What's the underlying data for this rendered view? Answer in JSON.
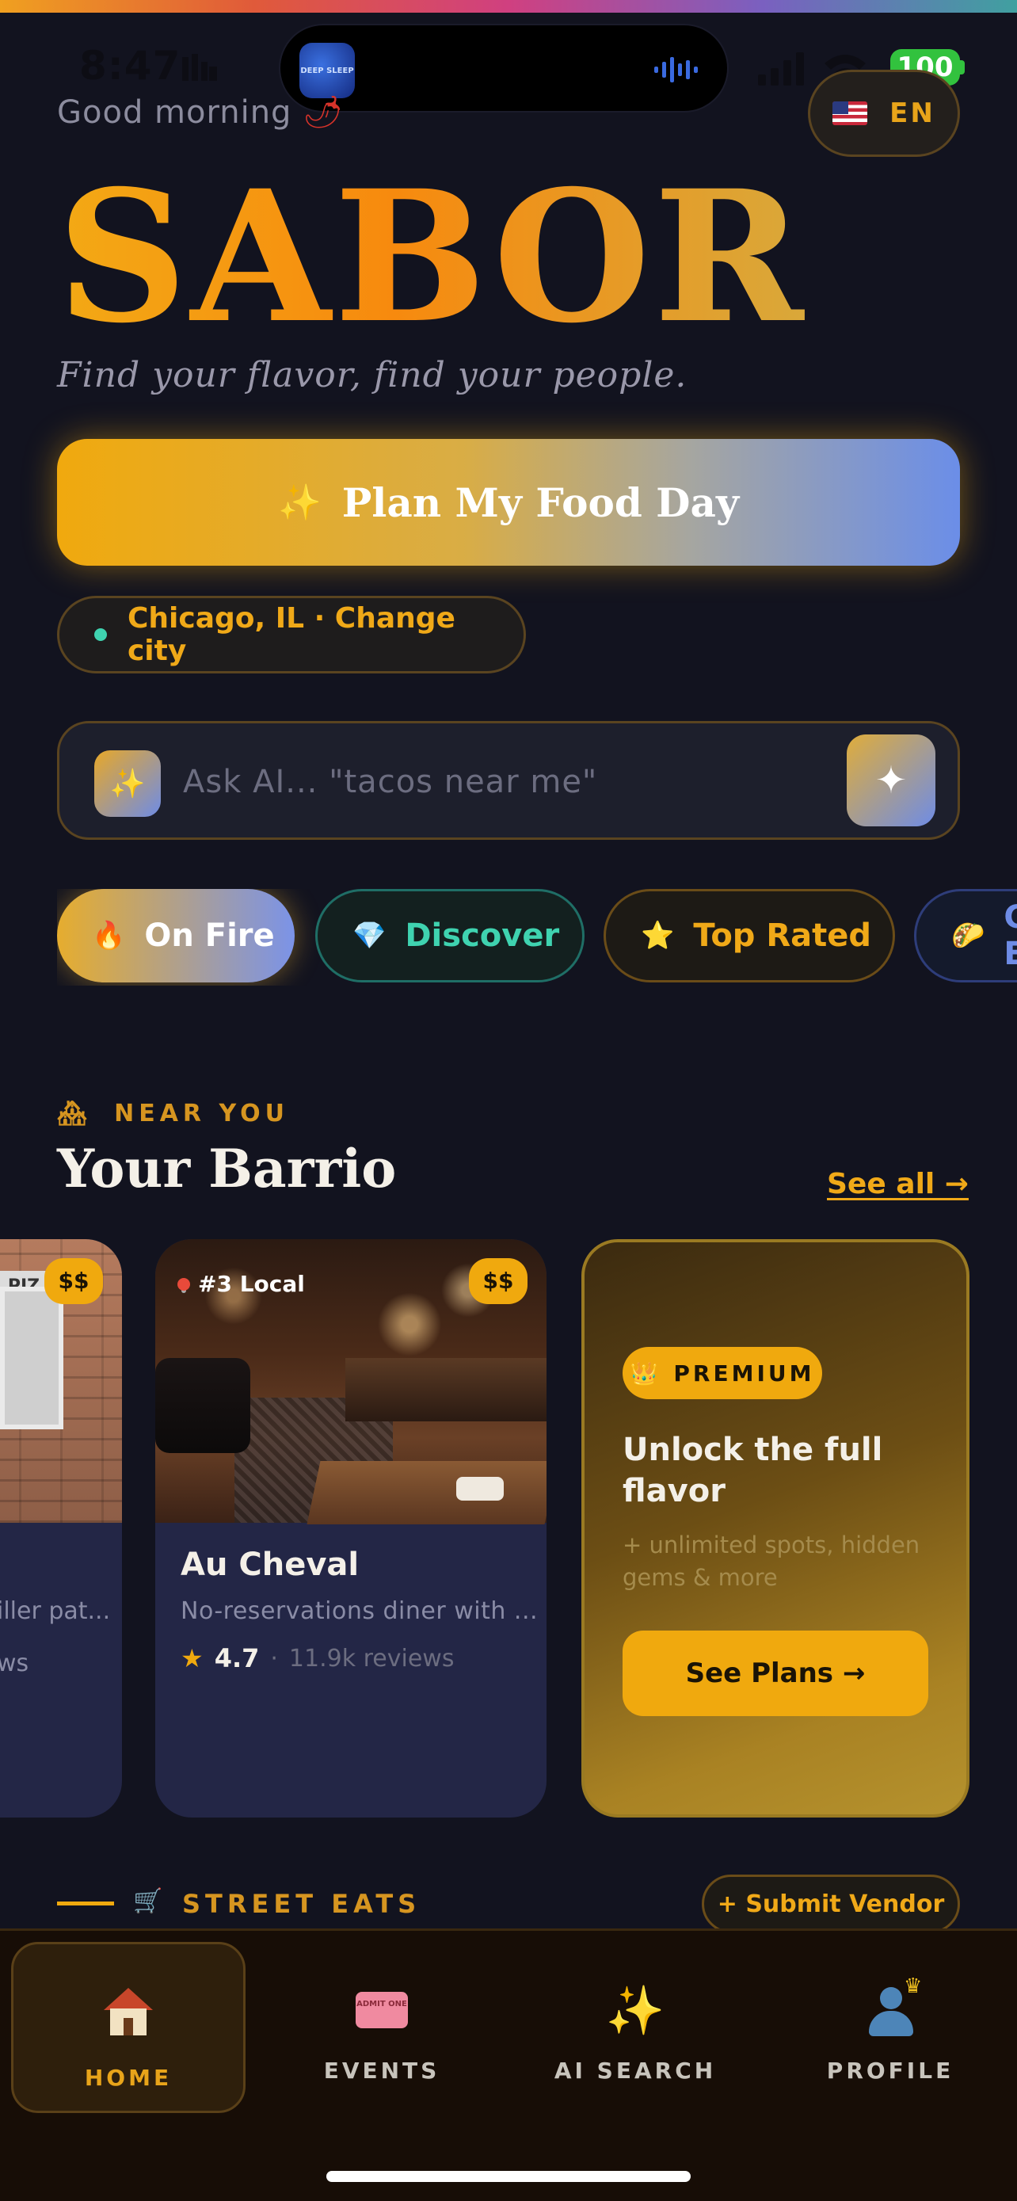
{
  "status_bar": {
    "time": "8:47",
    "battery": "100",
    "island_app_text": "DEEP SLEEP"
  },
  "header": {
    "greeting": "Good morning",
    "greeting_emoji": "🌶",
    "language_code": "EN",
    "brand": "SABOR",
    "tagline": "Find your flavor, find your people."
  },
  "plan_button": {
    "label": "Plan My Food Day",
    "icon": "sparkles-icon"
  },
  "city": {
    "label": "Chicago, IL · Change city"
  },
  "ask": {
    "placeholder": "Ask AI... \"tacos near me\"",
    "send_icon": "sparkle-icon"
  },
  "filters": [
    {
      "label": "On Fire",
      "icon": "🔥"
    },
    {
      "label": "Discover",
      "icon": "💎"
    },
    {
      "label": "Top Rated",
      "icon": "⭐"
    },
    {
      "label": "Cheap Eats",
      "icon": "🌮"
    }
  ],
  "near_section": {
    "eyebrow": "NEAR YOU",
    "eyebrow_icon": "🏘",
    "title": "Your Barrio",
    "see_all": "See all →"
  },
  "cards": {
    "partial": {
      "price": "$$",
      "sign": "PIZ",
      "desc": "iller pat...",
      "reviews": "ws"
    },
    "main": {
      "rank": "#3 Local",
      "price": "$$",
      "name": "Au Cheval",
      "desc": "No-reservations diner with ...",
      "rating": "4.7",
      "separator": "·",
      "reviews": "11.9k reviews"
    },
    "premium": {
      "badge": "PREMIUM",
      "badge_icon": "👑",
      "title": "Unlock the full flavor",
      "subtitle": "+ unlimited spots, hidden gems & more",
      "button": "See Plans →"
    }
  },
  "street_section": {
    "label": "STREET EATS",
    "icon": "🛒",
    "submit": "+ Submit Vendor"
  },
  "tabs": [
    {
      "label": "HOME"
    },
    {
      "label": "EVENTS",
      "ticket_text": "ADMIT ONE"
    },
    {
      "label": "AI SEARCH"
    },
    {
      "label": "PROFILE"
    }
  ],
  "colors": {
    "background": "#12131f",
    "accent_gold": "#f0a90e",
    "accent_blue": "#6e8ce6",
    "accent_teal": "#3fd3b0",
    "card_bg": "#232646"
  }
}
